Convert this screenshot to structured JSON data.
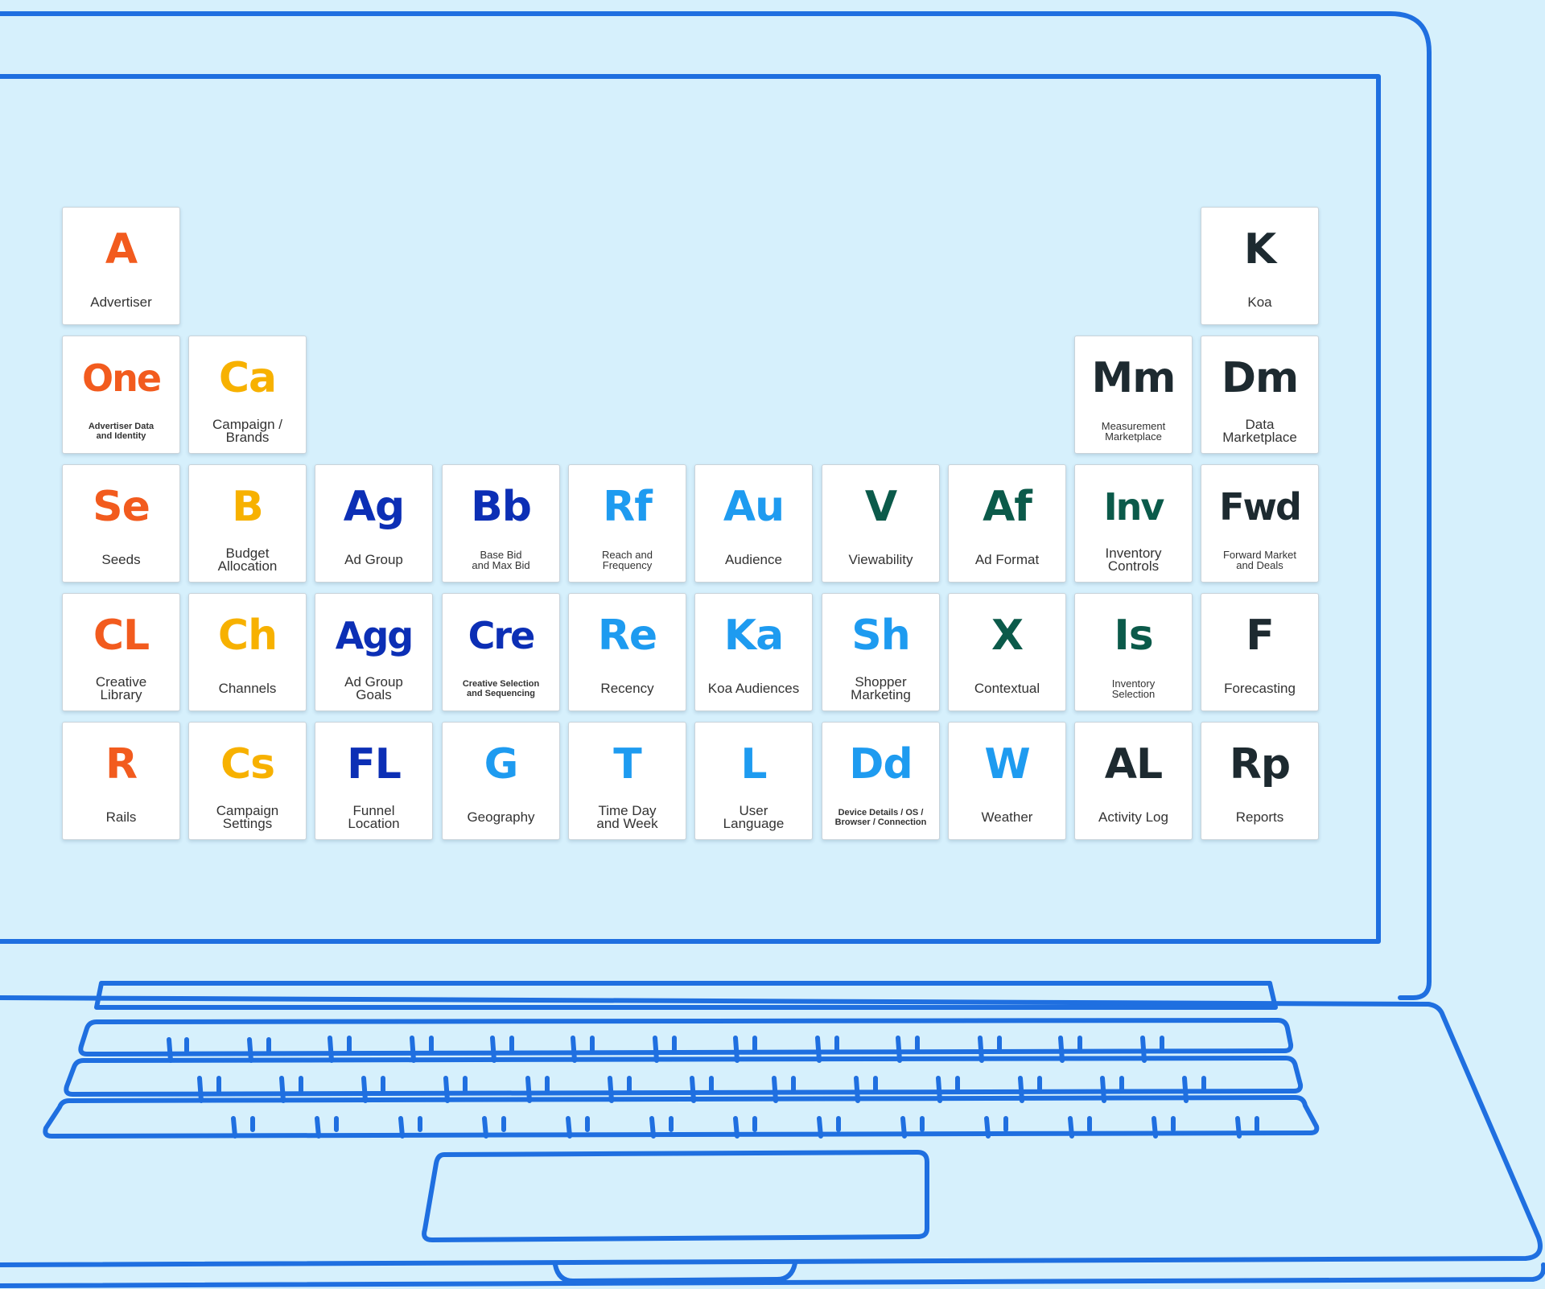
{
  "colors": {
    "background": "#d6f0fc",
    "outline": "#1f6fe0",
    "orange": "#f25b1e",
    "yellow": "#f7b100",
    "navy": "#0c2fb5",
    "lightblue": "#1e9bf0",
    "green": "#0b5a4a",
    "dark": "#1d2a30"
  },
  "elements": [
    {
      "symbol": "A",
      "name": "Advertiser",
      "color": "#f25b1e"
    },
    {
      "symbol": "K",
      "name": "Koa",
      "color": "#1d2a30"
    },
    {
      "symbol": "One",
      "name": "Advertiser Data\nand Identity",
      "color": "#f25b1e"
    },
    {
      "symbol": "Ca",
      "name": "Campaign /\nBrands",
      "color": "#f7b100"
    },
    {
      "symbol": "Mm",
      "name": "Measurement\nMarketplace",
      "color": "#1d2a30"
    },
    {
      "symbol": "Dm",
      "name": "Data\nMarketplace",
      "color": "#1d2a30"
    },
    {
      "symbol": "Se",
      "name": "Seeds",
      "color": "#f25b1e"
    },
    {
      "symbol": "B",
      "name": "Budget\nAllocation",
      "color": "#f7b100"
    },
    {
      "symbol": "Ag",
      "name": "Ad Group",
      "color": "#0c2fb5"
    },
    {
      "symbol": "Bb",
      "name": "Base Bid\nand Max Bid",
      "color": "#0c2fb5"
    },
    {
      "symbol": "Rf",
      "name": "Reach and\nFrequency",
      "color": "#1e9bf0"
    },
    {
      "symbol": "Au",
      "name": "Audience",
      "color": "#1e9bf0"
    },
    {
      "symbol": "V",
      "name": "Viewability",
      "color": "#0b5a4a"
    },
    {
      "symbol": "Af",
      "name": "Ad Format",
      "color": "#0b5a4a"
    },
    {
      "symbol": "Inv",
      "name": "Inventory\nControls",
      "color": "#0b5a4a"
    },
    {
      "symbol": "Fwd",
      "name": "Forward Market\nand Deals",
      "color": "#1d2a30"
    },
    {
      "symbol": "CL",
      "name": "Creative\nLibrary",
      "color": "#f25b1e"
    },
    {
      "symbol": "Ch",
      "name": "Channels",
      "color": "#f7b100"
    },
    {
      "symbol": "Agg",
      "name": "Ad Group\nGoals",
      "color": "#0c2fb5"
    },
    {
      "symbol": "Cre",
      "name": "Creative Selection\nand Sequencing",
      "color": "#0c2fb5"
    },
    {
      "symbol": "Re",
      "name": "Recency",
      "color": "#1e9bf0"
    },
    {
      "symbol": "Ka",
      "name": "Koa Audiences",
      "color": "#1e9bf0"
    },
    {
      "symbol": "Sh",
      "name": "Shopper\nMarketing",
      "color": "#1e9bf0"
    },
    {
      "symbol": "X",
      "name": "Contextual",
      "color": "#0b5a4a"
    },
    {
      "symbol": "Is",
      "name": "Inventory\nSelection",
      "color": "#0b5a4a"
    },
    {
      "symbol": "F",
      "name": "Forecasting",
      "color": "#1d2a30"
    },
    {
      "symbol": "R",
      "name": "Rails",
      "color": "#f25b1e"
    },
    {
      "symbol": "Cs",
      "name": "Campaign\nSettings",
      "color": "#f7b100"
    },
    {
      "symbol": "FL",
      "name": "Funnel\nLocation",
      "color": "#0c2fb5"
    },
    {
      "symbol": "G",
      "name": "Geography",
      "color": "#1e9bf0"
    },
    {
      "symbol": "T",
      "name": "Time Day\nand Week",
      "color": "#1e9bf0"
    },
    {
      "symbol": "L",
      "name": "User\nLanguage",
      "color": "#1e9bf0"
    },
    {
      "symbol": "Dd",
      "name": "Device Details / OS /\nBrowser / Connection",
      "color": "#1e9bf0"
    },
    {
      "symbol": "W",
      "name": "Weather",
      "color": "#1e9bf0"
    },
    {
      "symbol": "AL",
      "name": "Activity Log",
      "color": "#1d2a30"
    },
    {
      "symbol": "Rp",
      "name": "Reports",
      "color": "#1d2a30"
    }
  ]
}
